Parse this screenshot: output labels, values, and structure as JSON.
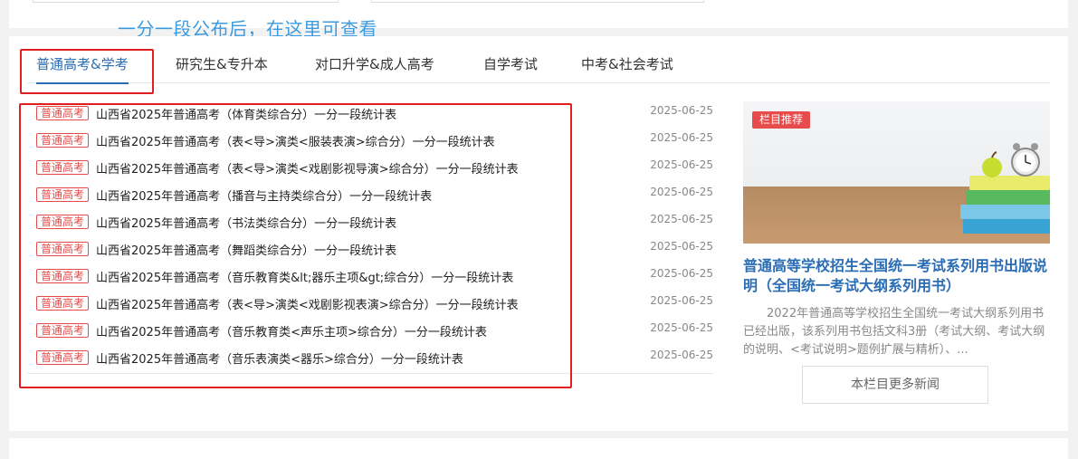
{
  "overlay_caption": "一分一段公布后，在这里可查看",
  "tabs": [
    {
      "label": "普通高考&学考"
    },
    {
      "label": "研究生&专升本"
    },
    {
      "label": "对口升学&成人高考"
    },
    {
      "label": "自学考试"
    },
    {
      "label": "中考&社会考试"
    }
  ],
  "news": [
    {
      "badge": "普通高考",
      "title": "山西省2025年普通高考（体育类综合分）一分一段统计表",
      "date": "2025-06-25"
    },
    {
      "badge": "普通高考",
      "title": "山西省2025年普通高考（表<导>演类<服装表演>综合分）一分一段统计表",
      "date": "2025-06-25"
    },
    {
      "badge": "普通高考",
      "title": "山西省2025年普通高考（表<导>演类<戏剧影视导演>综合分）一分一段统计表",
      "date": "2025-06-25"
    },
    {
      "badge": "普通高考",
      "title": "山西省2025年普通高考（播音与主持类综合分）一分一段统计表",
      "date": "2025-06-25"
    },
    {
      "badge": "普通高考",
      "title": "山西省2025年普通高考（书法类综合分）一分一段统计表",
      "date": "2025-06-25"
    },
    {
      "badge": "普通高考",
      "title": "山西省2025年普通高考（舞蹈类综合分）一分一段统计表",
      "date": "2025-06-25"
    },
    {
      "badge": "普通高考",
      "title": "山西省2025年普通高考（音乐教育类&lt;器乐主项&gt;综合分）一分一段统计表",
      "date": "2025-06-25"
    },
    {
      "badge": "普通高考",
      "title": "山西省2025年普通高考（表<导>演类<戏剧影视表演>综合分）一分一段统计表",
      "date": "2025-06-25"
    },
    {
      "badge": "普通高考",
      "title": "山西省2025年普通高考（音乐教育类<声乐主项>综合分）一分一段统计表",
      "date": "2025-06-25"
    },
    {
      "badge": "普通高考",
      "title": "山西省2025年普通高考（音乐表演类<器乐>综合分）一分一段统计表",
      "date": "2025-06-25"
    }
  ],
  "feature": {
    "badge": "栏目推荐",
    "title": "普通高等学校招生全国统一考试系列用书出版说明（全国统一考试大纲系列用书）",
    "description": "2022年普通高等学校招生全国统一考试大纲系列用书已经出版，该系列用书包括文科3册（考试大纲、考试大纲的说明、<考试说明>题例扩展与精析）、...",
    "more_button": "本栏目更多新闻"
  }
}
